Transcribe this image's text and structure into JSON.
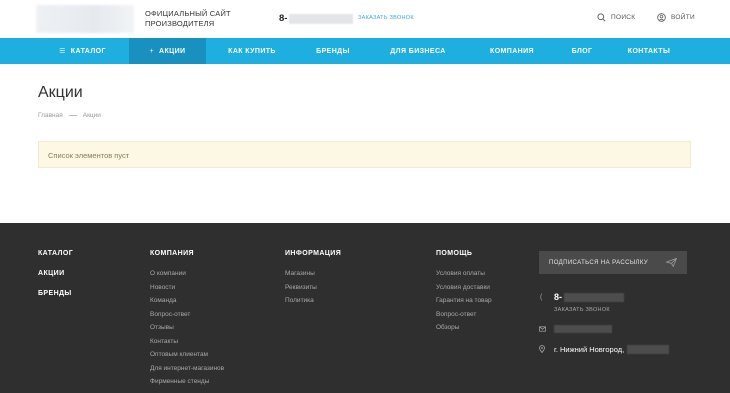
{
  "header": {
    "tagline": "ОФИЦИАЛЬНЫЙ САЙТ ПРОИЗВОДИТЕЛЯ",
    "phone_prefix": "8-",
    "callback": "ЗАКАЗАТЬ ЗВОНОК",
    "search": "ПОИСК",
    "login": "ВОЙТИ"
  },
  "nav": {
    "catalog": "КАТАЛОГ",
    "actions": "АКЦИИ",
    "how_to_buy": "КАК КУПИТЬ",
    "brands": "БРЕНДЫ",
    "business": "ДЛЯ БИЗНЕСА",
    "company": "КОМПАНИЯ",
    "blog": "БЛОГ",
    "contacts": "КОНТАКТЫ"
  },
  "main": {
    "title": "Акции",
    "breadcrumb": [
      "Главная",
      "Акции"
    ],
    "empty_notice": "Список элементов пуст"
  },
  "footer": {
    "col1": [
      "КАТАЛОГ",
      "АКЦИИ",
      "БРЕНДЫ"
    ],
    "company": {
      "title": "КОМПАНИЯ",
      "links": [
        "О компании",
        "Новости",
        "Команда",
        "Вопрос-ответ",
        "Отзывы",
        "Контакты",
        "Оптовым клиентам",
        "Для интернет-магазинов",
        "Фирменные стенды"
      ]
    },
    "info": {
      "title": "ИНФОРМАЦИЯ",
      "links": [
        "Магазины",
        "Реквизиты",
        "Политика"
      ]
    },
    "help": {
      "title": "ПОМОЩЬ",
      "links": [
        "Условия оплаты",
        "Условия доставки",
        "Гарантия на товар",
        "Вопрос-ответ",
        "Обзоры"
      ]
    },
    "subscribe": "ПОДПИСАТЬСЯ НА РАССЫЛКУ",
    "phone_prefix": "8-",
    "callback": "ЗАКАЗАТЬ ЗВОНОК",
    "address": "г. Нижний Новгород,"
  },
  "colors": {
    "accent": "#1eaee0",
    "accent_active": "#1891c1",
    "footer_bg": "#2f2f2f",
    "notice_bg": "#fcf8e3"
  }
}
